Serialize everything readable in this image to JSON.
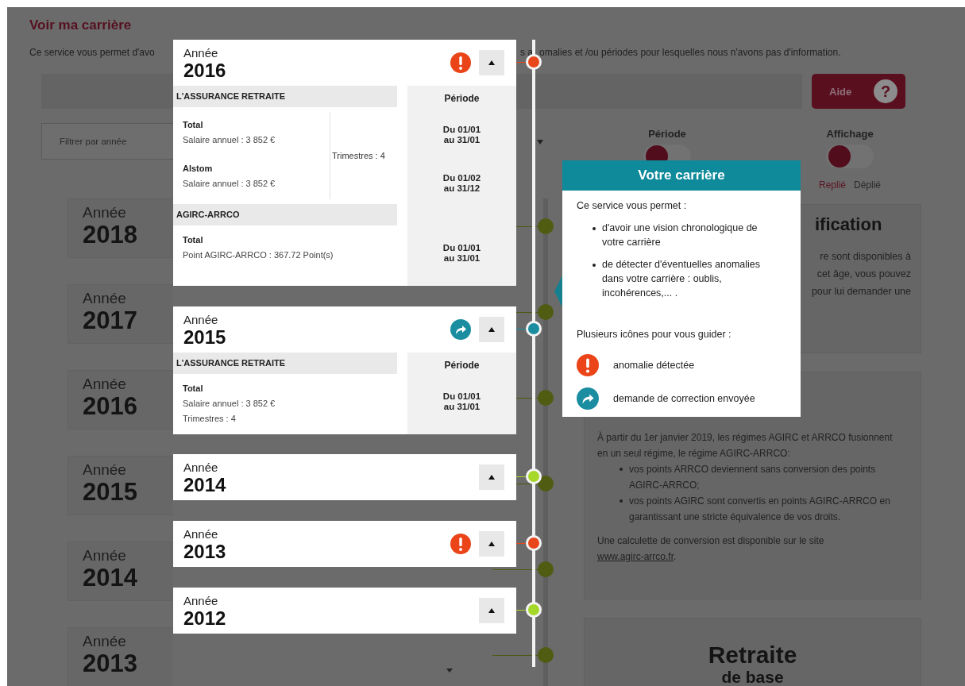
{
  "page": {
    "title": "Voir ma carrière",
    "intro_fragments": [
      "Ce service vous permet d'avo",
      "s a",
      "omalies et /ou périodes pour lesquelles nous n'avons pas d'information."
    ]
  },
  "help_button": {
    "label": "Aide",
    "icon_text": "?"
  },
  "filter": {
    "label": "Filtrer par année"
  },
  "toggles": [
    {
      "label": "Période",
      "on": false
    },
    {
      "label": "Affichage",
      "on": false,
      "options": [
        {
          "label": "Replié",
          "selected": true
        },
        {
          "label": "Déplié",
          "selected": false
        }
      ]
    }
  ],
  "background_years": [
    {
      "label": "Année",
      "year": "2018"
    },
    {
      "label": "Année",
      "year": "2017"
    },
    {
      "label": "Année",
      "year": "2016"
    },
    {
      "label": "Année",
      "year": "2015"
    },
    {
      "label": "Année",
      "year": "2014"
    },
    {
      "label": "Année",
      "year": "2013"
    }
  ],
  "side_panels": [
    {
      "kind": "info",
      "heading": "ification",
      "lines": [
        "re sont disponibles à",
        "cet âge, vous pouvez",
        "pour lui demander une"
      ]
    },
    {
      "kind": "agirc",
      "paragraph": "À partir du 1er janvier 2019, les régimes AGIRC et ARRCO fusionnent en un seul régime, le régime AGIRC-ARRCO:",
      "bullets": [
        "vos points ARRCO deviennent sans conversion des points AGIRC-ARRCO;",
        "vos points AGIRC sont convertis en points AGIRC-ARRCO en garantissant une stricte équivalence de vos droits."
      ],
      "note": {
        "text": "Une calculette de conversion est disponible sur le site",
        "link": "www.agirc-arrco.fr",
        "after": "."
      }
    },
    {
      "kind": "title",
      "heading": "Retraite",
      "subheading": "de base"
    }
  ],
  "timeline_cards": [
    {
      "label": "Année",
      "year": "2016",
      "kind": "anomaly",
      "color": "#e8461b",
      "details": {
        "period_header": "Période",
        "sections": [
          {
            "name": "L'ASSURANCE RETRAITE",
            "side_note": "Trimestres : 4",
            "entries": [
              {
                "title": "Total",
                "lines": [
                  "Salaire annuel : 3 852 €"
                ],
                "period": [
                  "Du 01/01",
                  "au 31/01"
                ]
              },
              {
                "title": "Alstom",
                "lines": [
                  "Salaire annuel : 3 852 €"
                ],
                "period": [
                  "Du 01/02",
                  "au 31/12"
                ]
              }
            ]
          },
          {
            "name": "AGIRC-ARRCO",
            "entries": [
              {
                "title": "Total",
                "lines": [
                  "Point AGIRC-ARRCO :  367.72 Point(s)"
                ],
                "period": [
                  "Du 01/01",
                  "au 31/01"
                ]
              }
            ]
          }
        ]
      }
    },
    {
      "label": "Année",
      "year": "2015",
      "kind": "correction_sent",
      "color": "#1a8da0",
      "details": {
        "period_header": "Période",
        "sections": [
          {
            "name": "L'ASSURANCE RETRAITE",
            "entries": [
              {
                "title": "Total",
                "lines": [
                  "Salaire annuel : 3 852 €",
                  "Trimestres : 4"
                ],
                "period": [
                  "Du 01/01",
                  "au 31/01"
                ]
              }
            ]
          }
        ]
      }
    },
    {
      "label": "Année",
      "year": "2014",
      "kind": "plain",
      "color": "#a6d82a"
    },
    {
      "label": "Année",
      "year": "2013",
      "kind": "anomaly",
      "color": "#e8461b"
    },
    {
      "label": "Année",
      "year": "2012",
      "kind": "plain",
      "color": "#a6d82a"
    }
  ],
  "tooltip": {
    "title": "Votre carrière",
    "intro": "Ce service vous permet :",
    "bullets": [
      "d'avoir une vision chronologique de votre carrière",
      "de détecter d'éventuelles anomalies dans votre carrière : oublis, incohérences,... ."
    ],
    "subheading": "Plusieurs icônes pour vous guider :",
    "legend": [
      {
        "kind": "anomaly",
        "label": "anomalie détectée"
      },
      {
        "kind": "correction_sent",
        "label": "demande de correction envoyée"
      }
    ]
  }
}
